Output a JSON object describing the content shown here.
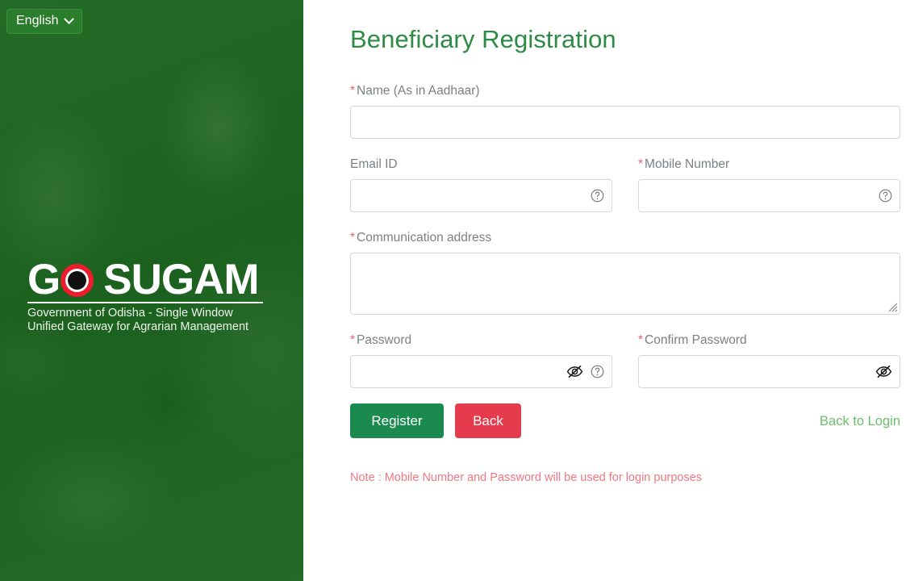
{
  "sidebar": {
    "language_selector": {
      "label": "English",
      "chevron_icon": "chevron-down-icon"
    },
    "logo": {
      "text_before_o": "G",
      "o_mark": "red-ring-o-icon",
      "text_after_o": "SUGAM",
      "tagline_line1": "Government of Odisha - Single Window",
      "tagline_line2": "Unified Gateway for Agrarian Management"
    },
    "background_color": "#1d6620"
  },
  "main": {
    "title": "Beneficiary Registration",
    "title_color": "#2e8b45",
    "fields": {
      "name": {
        "label": "Name (As in Aadhaar)",
        "required": true,
        "value": "",
        "placeholder": ""
      },
      "email": {
        "label": "Email ID",
        "required": false,
        "value": "",
        "placeholder": "",
        "help_icon": "help-circle-icon"
      },
      "mobile": {
        "label": "Mobile Number",
        "required": true,
        "value": "",
        "placeholder": "",
        "help_icon": "help-circle-icon"
      },
      "address": {
        "label": "Communication address",
        "required": true,
        "value": "",
        "placeholder": "",
        "resize_handle": "resize-grip-icon"
      },
      "password": {
        "label": "Password",
        "required": true,
        "value": "",
        "placeholder": "",
        "visibility_icon": "eye-off-icon",
        "help_icon": "help-circle-icon"
      },
      "confirm_password": {
        "label": "Confirm Password",
        "required": true,
        "value": "",
        "placeholder": "",
        "visibility_icon": "eye-off-icon"
      }
    },
    "actions": {
      "register_label": "Register",
      "register_color": "#1b8a4e",
      "back_label": "Back",
      "back_color": "#e43b4d",
      "back_to_login_label": "Back to Login",
      "back_to_login_color": "#6abf69"
    },
    "note": "Note : Mobile Number and Password will be used for login purposes",
    "note_color": "#ef7882",
    "required_marker": "*",
    "required_marker_color": "#e8626c"
  }
}
